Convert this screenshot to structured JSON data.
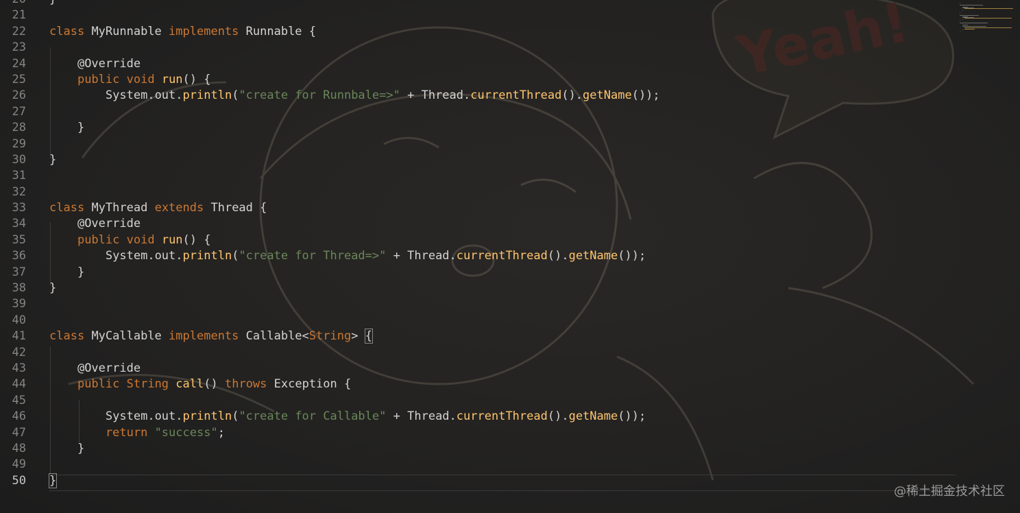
{
  "editor": {
    "theme": {
      "keyword": "#cc7832",
      "function": "#ffc66d",
      "string": "#6a8759",
      "text": "#d4d4d4",
      "line_number": "#858585"
    },
    "lines": [
      {
        "n": "20",
        "code": "}"
      },
      {
        "n": "21",
        "code": ""
      },
      {
        "n": "22",
        "code": "class MyRunnable implements Runnable {"
      },
      {
        "n": "23",
        "code": ""
      },
      {
        "n": "24",
        "code": "    @Override"
      },
      {
        "n": "25",
        "code": "    public void run() {"
      },
      {
        "n": "26",
        "code": "        System.out.println(\"create for Runnbale=>\" + Thread.currentThread().getName());"
      },
      {
        "n": "27",
        "code": ""
      },
      {
        "n": "28",
        "code": "    }"
      },
      {
        "n": "29",
        "code": ""
      },
      {
        "n": "30",
        "code": "}"
      },
      {
        "n": "31",
        "code": ""
      },
      {
        "n": "32",
        "code": ""
      },
      {
        "n": "33",
        "code": "class MyThread extends Thread {"
      },
      {
        "n": "34",
        "code": "    @Override"
      },
      {
        "n": "35",
        "code": "    public void run() {"
      },
      {
        "n": "36",
        "code": "        System.out.println(\"create for Thread=>\" + Thread.currentThread().getName());"
      },
      {
        "n": "37",
        "code": "    }"
      },
      {
        "n": "38",
        "code": "}"
      },
      {
        "n": "39",
        "code": ""
      },
      {
        "n": "40",
        "code": ""
      },
      {
        "n": "41",
        "code": "class MyCallable implements Callable<String> {"
      },
      {
        "n": "42",
        "code": ""
      },
      {
        "n": "43",
        "code": "    @Override"
      },
      {
        "n": "44",
        "code": "    public String call() throws Exception {"
      },
      {
        "n": "45",
        "code": ""
      },
      {
        "n": "46",
        "code": "        System.out.println(\"create for Callable\" + Thread.currentThread().getName());"
      },
      {
        "n": "47",
        "code": "        return \"success\";"
      },
      {
        "n": "48",
        "code": "    }"
      },
      {
        "n": "49",
        "code": ""
      },
      {
        "n": "50",
        "code": "}"
      }
    ],
    "current_line": "50"
  },
  "background_art": {
    "speech_bubble_text": "Yeah!"
  },
  "watermark": "@稀土掘金技术社区"
}
